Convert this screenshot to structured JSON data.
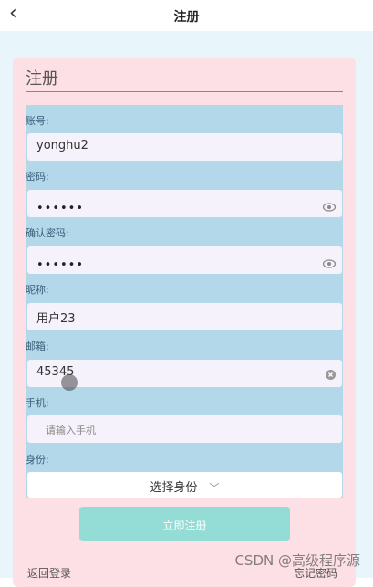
{
  "nav": {
    "back_icon": "chevron-left-icon",
    "title": "注册"
  },
  "card": {
    "title": "注册"
  },
  "fields": {
    "account": {
      "label": "账号:",
      "value": "yonghu2"
    },
    "password": {
      "label": "密码:",
      "value": "••••••"
    },
    "confirm": {
      "label": "确认密码:",
      "value": "••••••"
    },
    "nickname": {
      "label": "昵称:",
      "value": "用户23"
    },
    "email": {
      "label": "邮箱:",
      "value": "45345"
    },
    "phone": {
      "label": "手机:",
      "placeholder": "请输入手机"
    },
    "identity": {
      "label": "身份:",
      "value": "选择身份"
    }
  },
  "buttons": {
    "submit": "立即注册"
  },
  "links": {
    "back_to_login": "返回登录",
    "forgot_password": "忘记密码"
  },
  "watermark": "CSDN @高级程序源",
  "colors": {
    "card": "#fde0e5",
    "form_area": "#b2d8ea",
    "input_bg": "#f5f2fb",
    "submit_button": "#93ddd6",
    "page_bg": "#e8f6fb"
  }
}
